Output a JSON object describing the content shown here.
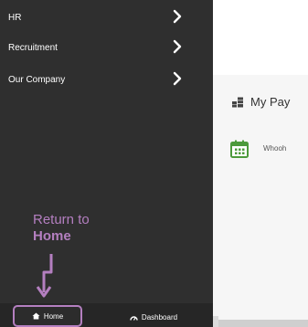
{
  "sidebar": {
    "items": [
      {
        "label": "HR",
        "icon": "chevron-right-icon"
      },
      {
        "label": "Recruitment",
        "icon": "chevron-right-icon"
      },
      {
        "label": "Our Company",
        "icon": "chevron-right-icon"
      }
    ],
    "bottom_tabs": [
      {
        "label": "Home",
        "icon": "home-icon"
      },
      {
        "label": "Dashboard",
        "icon": "dashboard-icon"
      }
    ]
  },
  "annotation": {
    "line1": "Return to",
    "line2": "Home",
    "color": "#b47fc0"
  },
  "main": {
    "card_title": "My Pay",
    "card_icon": "money-icon",
    "calendar_icon": "calendar-icon",
    "calendar_text": "Whooh"
  },
  "colors": {
    "sidebar_bg": "#2f2f2f",
    "highlight": "#b47fc0",
    "calendar_green": "#4c9a3b"
  }
}
